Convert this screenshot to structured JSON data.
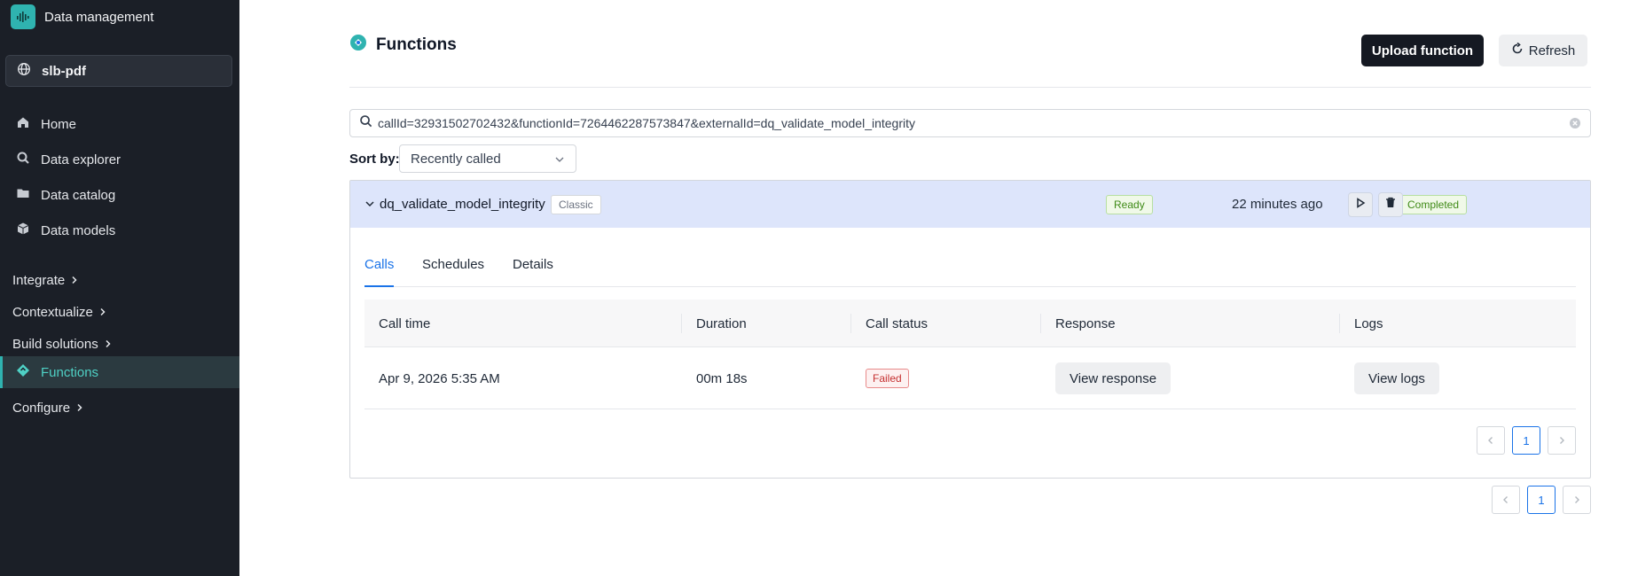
{
  "app": {
    "title": "Data management",
    "logo_icon": "grid-logo-icon",
    "accent": "#2fb3b0"
  },
  "project": {
    "name": "slb-pdf"
  },
  "sidebar": {
    "items": [
      {
        "label": "Home",
        "icon": "home-icon"
      },
      {
        "label": "Data explorer",
        "icon": "search-icon"
      },
      {
        "label": "Data catalog",
        "icon": "folder-icon"
      },
      {
        "label": "Data models",
        "icon": "cube-icon"
      }
    ],
    "sections": {
      "integrate": "Integrate",
      "contextualize": "Contextualize",
      "build_solutions": "Build solutions",
      "functions": "Functions",
      "configure": "Configure"
    }
  },
  "header": {
    "title": "Functions",
    "upload_label": "Upload function",
    "refresh_label": "Refresh"
  },
  "search": {
    "value": "callId=32931502702432&functionId=7264462287573847&externalId=dq_validate_model_integrity"
  },
  "sort": {
    "label": "Sort by:",
    "value": "Recently called"
  },
  "function": {
    "name": "dq_validate_model_integrity",
    "type_tag": "Classic",
    "status": "Ready",
    "last_called": "22 minutes ago",
    "last_call_status": "Completed"
  },
  "tabs": [
    "Calls",
    "Schedules",
    "Details"
  ],
  "calls_table": {
    "columns": [
      "Call time",
      "Duration",
      "Call status",
      "Response",
      "Logs"
    ],
    "rows": [
      {
        "call_time": "Apr 9, 2026 5:35 AM",
        "duration": "00m 18s",
        "status": "Failed",
        "response_label": "View response",
        "logs_label": "View logs"
      }
    ]
  },
  "pagination": {
    "inner_page": "1",
    "outer_page": "1"
  }
}
